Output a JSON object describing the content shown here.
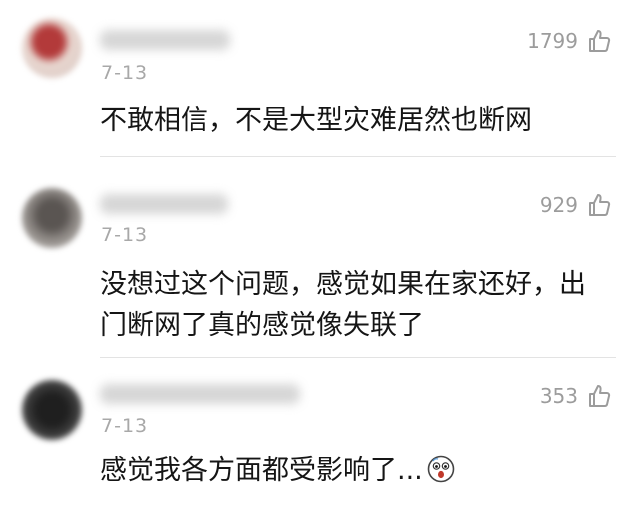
{
  "comments": [
    {
      "date": "7-13",
      "likes": "1799",
      "text": "不敢相信，不是大型灾难居然也断网"
    },
    {
      "date": "7-13",
      "likes": "929",
      "text": "没想过这个问题，感觉如果在家还好，出门断网了真的感觉像失联了"
    },
    {
      "date": "7-13",
      "likes": "353",
      "text": "感觉我各方面都受影响了..."
    }
  ],
  "icons": {
    "like": "thumbs-up-outline-icon",
    "emoji": "scared-face-emoji-icon"
  },
  "colors": {
    "muted_text": "#9c9c9c",
    "body_text": "#151515",
    "divider": "#e3e3e3"
  }
}
